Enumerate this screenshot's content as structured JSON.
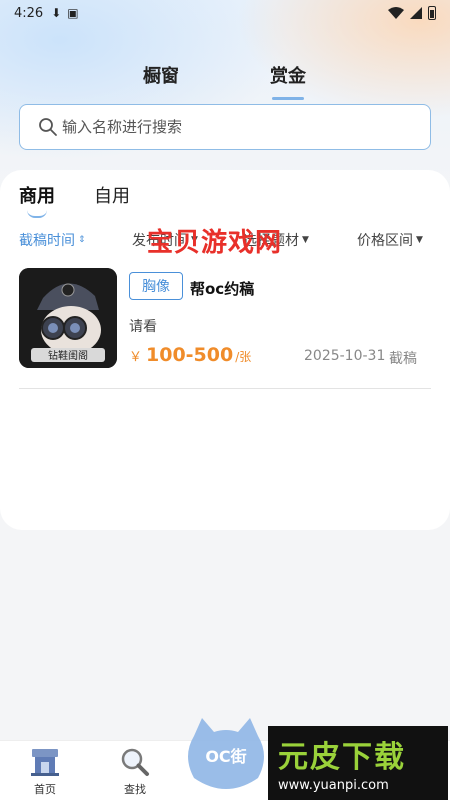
{
  "status_bar": {
    "time": "4:26"
  },
  "top_tabs": [
    {
      "label": "橱窗"
    },
    {
      "label": "赏金"
    }
  ],
  "search": {
    "placeholder": "输入名称进行搜索"
  },
  "sub_tabs": [
    {
      "label": "商用"
    },
    {
      "label": "自用"
    }
  ],
  "filters": [
    {
      "label": "截稿时间"
    },
    {
      "label": "发布时间"
    },
    {
      "label": "选择题材"
    },
    {
      "label": "价格区间"
    }
  ],
  "overlay_watermark": "宝贝游戏网",
  "items": [
    {
      "badge": "胸像",
      "title": "帮oc约稿",
      "desc": "请看",
      "currency": "￥",
      "price": "100-500",
      "unit": "/张",
      "date": "2025-10-31",
      "status": "截稿",
      "thumb_caption": "钻鞋闺阁"
    }
  ],
  "bottom_nav": [
    {
      "label": "首页",
      "icon": "shop-icon"
    },
    {
      "label": "查找",
      "icon": "magnifier-icon"
    }
  ],
  "branding": {
    "logo_text": "OC街",
    "site_big": "元皮下载",
    "site_url": "www.yuanpi.com"
  },
  "colors": {
    "accent": "#4a90d9",
    "price": "#f08c2a",
    "watermark": "#e8302a"
  }
}
